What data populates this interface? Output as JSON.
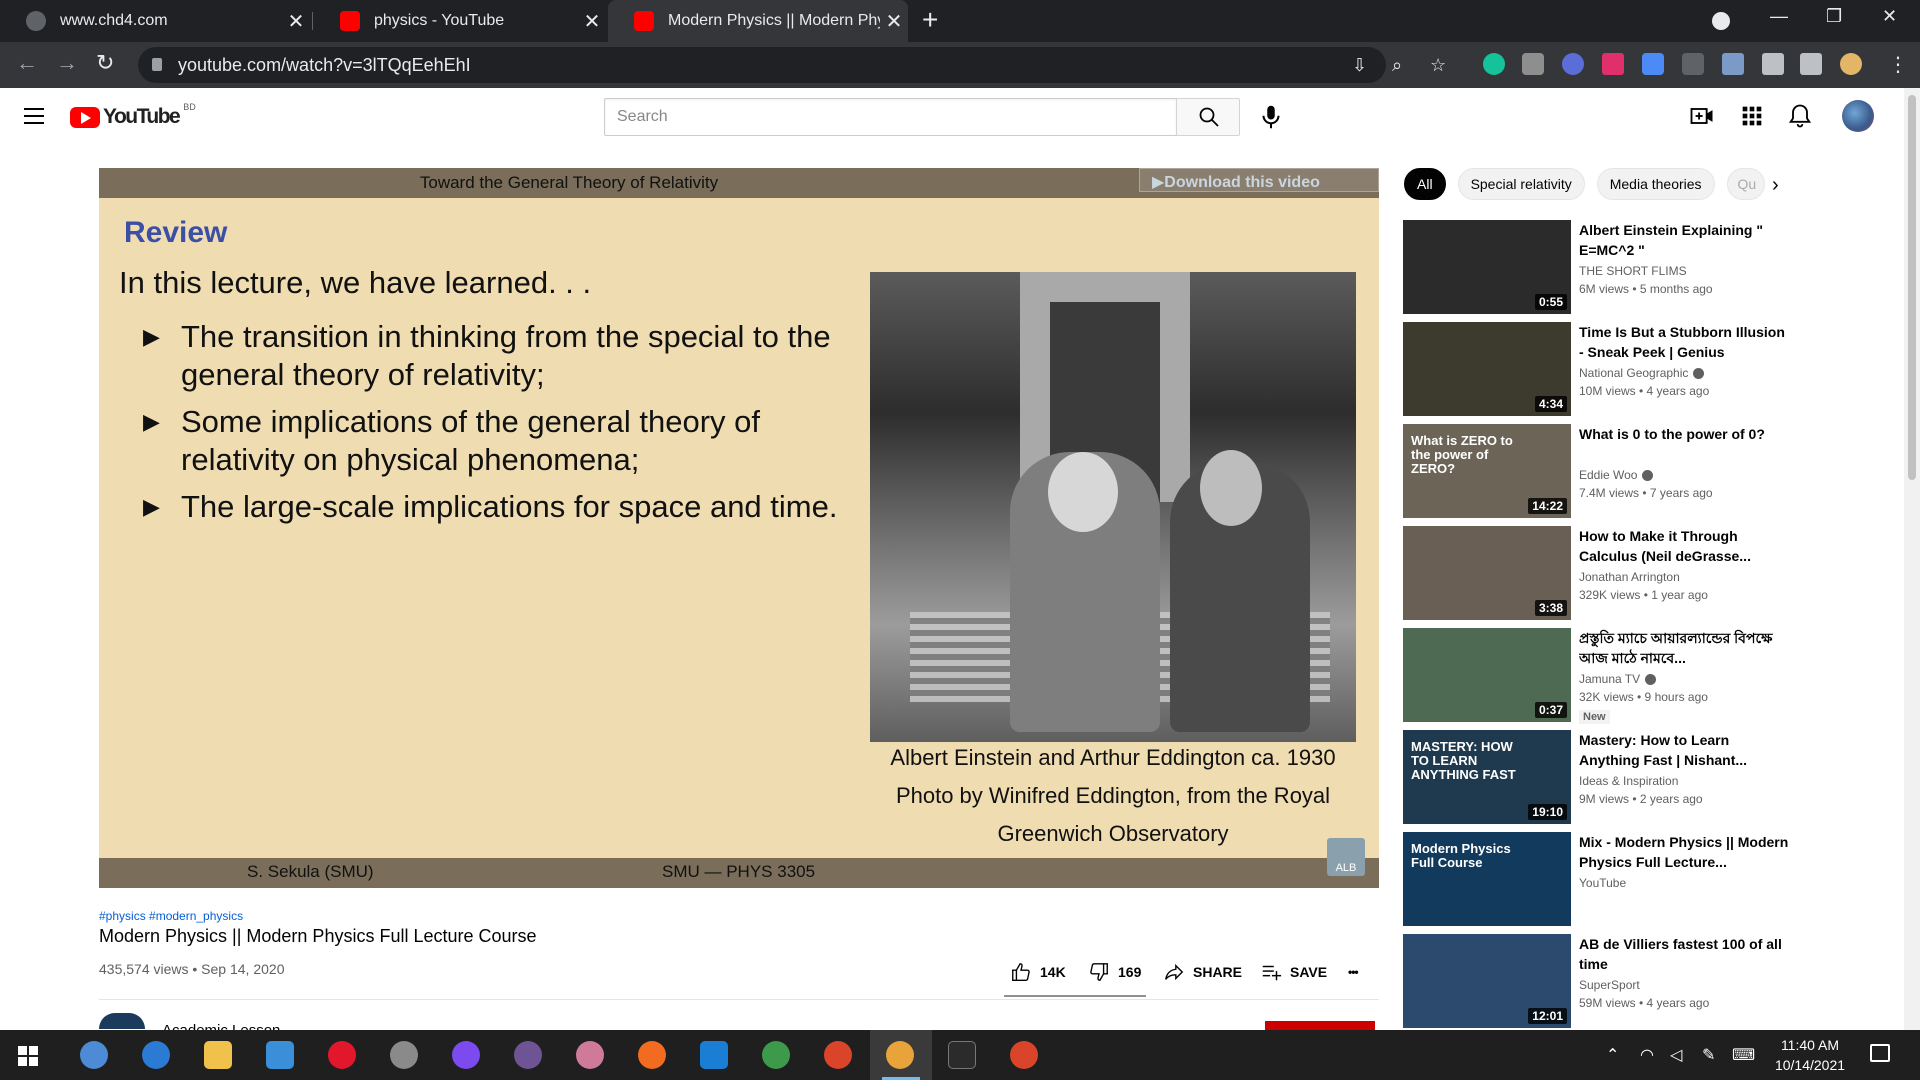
{
  "browser": {
    "tabs": [
      {
        "title": "www.chd4.com",
        "active": false
      },
      {
        "title": "physics - YouTube",
        "active": false
      },
      {
        "title": "Modern Physics || Modern Physic",
        "active": true
      }
    ],
    "url": "youtube.com/watch?v=3lTQqEehEhI"
  },
  "yt_header": {
    "logo_text": "YouTube",
    "country_code": "BD",
    "search_placeholder": "Search"
  },
  "slide": {
    "top_title": "Toward the General Theory of Relativity",
    "download_overlay": "▶Download this video",
    "heading": "Review",
    "lead": "In this lecture, we have learned. . .",
    "bullets": [
      {
        "line1": "The transition in thinking from the special to the",
        "line2": "general theory of relativity;"
      },
      {
        "line1": "Some implications of the general theory of",
        "line2": "relativity on physical phenomena;"
      },
      {
        "line1": "The large-scale implications for space and time.",
        "line2": ""
      }
    ],
    "caption_lines": [
      "Albert Einstein and Arthur Eddington ca. 1930",
      "Photo by Winifred Eddington, from the Royal",
      "Greenwich Observatory"
    ],
    "footer_left": "S. Sekula  (SMU)",
    "footer_mid": "SMU — PHYS 3305",
    "watermark": "ALB"
  },
  "video": {
    "hashtags": "#physics #modern_physics",
    "title": "Modern Physics || Modern Physics Full Lecture Course",
    "view_info": "435,574 views • Sep 14, 2020",
    "likes": "14K",
    "dislikes": "169",
    "share_label": "SHARE",
    "save_label": "SAVE",
    "more_label": "•••",
    "channel_name": "Academic Lesson"
  },
  "chips": [
    "All",
    "Special relativity",
    "Media theories",
    "Qu"
  ],
  "recommendations": [
    {
      "title": "Albert Einstein Explaining \" E=MC^2 \"",
      "channel": "THE SHORT FLIMS",
      "verified": false,
      "meta": "6M views • 5 months ago",
      "duration": "0:55",
      "new": false,
      "thumb_color": "#2b2b2b"
    },
    {
      "title": "Time Is But a Stubborn Illusion - Sneak Peek | Genius",
      "channel": "National Geographic",
      "verified": true,
      "meta": "10M views • 4 years ago",
      "duration": "4:34",
      "new": false,
      "thumb_color": "#3d3a2e"
    },
    {
      "title": "What is 0 to the power of 0?",
      "channel": "Eddie Woo",
      "verified": true,
      "meta": "7.4M views • 7 years ago",
      "duration": "14:22",
      "new": false,
      "thumb_color": "#6d6458",
      "thumb_text": "What is ZERO to the power of ZERO?"
    },
    {
      "title": "How to Make it Through Calculus (Neil deGrasse...",
      "channel": "Jonathan Arrington",
      "verified": false,
      "meta": "329K views • 1 year ago",
      "duration": "3:38",
      "new": false,
      "thumb_color": "#6a5f55"
    },
    {
      "title": "প্রস্তুতি ম্যাচে আয়ারল্যান্ডের বিপক্ষে আজ মাঠে নামবে...",
      "channel": "Jamuna TV",
      "verified": true,
      "meta": "32K views • 9 hours ago",
      "duration": "0:37",
      "new": true,
      "new_label": "New",
      "thumb_color": "#4f6a52"
    },
    {
      "title": "Mastery: How to Learn Anything Fast | Nishant...",
      "channel": "Ideas & Inspiration",
      "verified": false,
      "meta": "9M views • 2 years ago",
      "duration": "19:10",
      "new": false,
      "thumb_color": "#1f3a4e",
      "thumb_text": "MASTERY: HOW TO LEARN ANYTHING FAST"
    },
    {
      "title": "Mix - Modern Physics || Modern Physics Full Lecture...",
      "channel": "YouTube",
      "verified": false,
      "meta": "",
      "duration": "",
      "new": false,
      "thumb_color": "#123a5c",
      "thumb_text": "Modern Physics Full Course"
    },
    {
      "title": "AB de Villiers fastest 100 of all time",
      "channel": "SuperSport",
      "verified": false,
      "meta": "59M views • 4 years ago",
      "duration": "12:01",
      "new": false,
      "thumb_color": "#2c4a6e"
    }
  ],
  "taskbar": {
    "time": "11:40 AM",
    "date": "10/14/2021"
  },
  "colors": {
    "yt_red": "#ff0000",
    "chrome_dark": "#202124",
    "slide_bg": "#efdcb0",
    "review_blue": "#3b4fa6"
  }
}
